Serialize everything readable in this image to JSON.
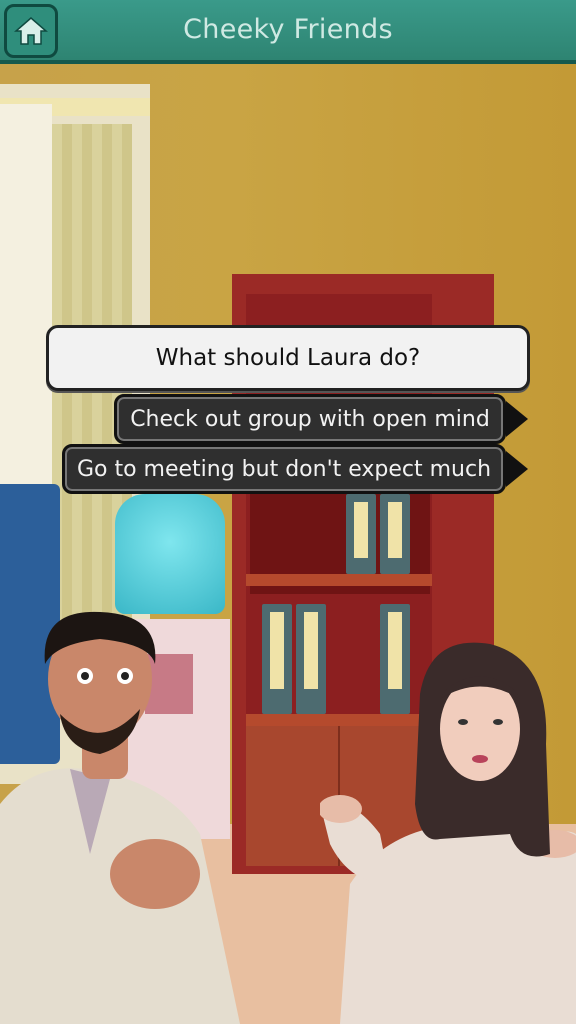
{
  "app": {
    "title": "Cheeky Friends"
  },
  "toolbar": {
    "home_icon": "home-icon"
  },
  "dialogue": {
    "prompt": "What should Laura do?",
    "choices": [
      {
        "label": "Check out group with open mind"
      },
      {
        "label": "Go to meeting but don't expect much"
      }
    ]
  },
  "colors": {
    "topbar": "#2e8472",
    "title_text": "#cfe9e3",
    "choice_bg": "#2f2f2f",
    "prompt_bg": "#f2f2f2"
  }
}
